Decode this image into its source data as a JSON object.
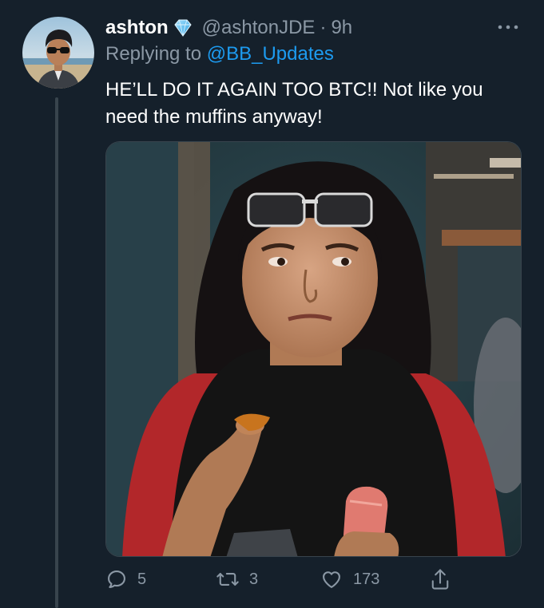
{
  "tweet": {
    "display_name": "ashton",
    "handle": "@ashtonJDE",
    "separator": "·",
    "time": "9h",
    "replying_prefix": "Replying to",
    "replying_to": "@BB_Updates",
    "text": "HE’LL DO IT AGAIN TOO BTC!! Not like you need the muffins anyway!",
    "media_icon": "photo-of-woman-eating",
    "avatar_icon": "profile-avatar",
    "verified_icon": "verified-badge-icon"
  },
  "actions": {
    "reply_count": "5",
    "retweet_count": "3",
    "like_count": "173"
  },
  "colors": {
    "background": "#15202b",
    "secondary_text": "#8b98a5",
    "accent": "#1d9bf0",
    "thread_line": "#38444d"
  }
}
